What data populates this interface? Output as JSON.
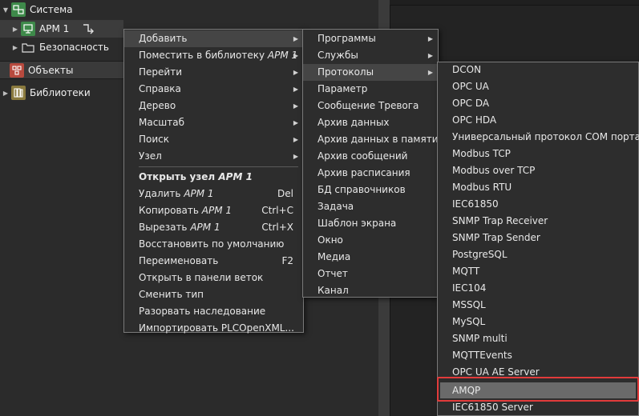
{
  "tree": {
    "sistema": "Система",
    "arm1": "АРМ 1",
    "bezopasnost": "Безопасность",
    "obekty": "Объекты",
    "biblioteki": "Библиотеки"
  },
  "menu_main": {
    "items": [
      {
        "label": "Добавить",
        "submenu": true
      },
      {
        "label": "Поместить в библиотеку ",
        "italic": "АРМ 1",
        "submenu": true
      },
      {
        "label": "Перейти",
        "submenu": true
      },
      {
        "label": "Справка",
        "submenu": true
      },
      {
        "label": "Дерево",
        "submenu": true
      },
      {
        "label": "Масштаб",
        "submenu": true
      },
      {
        "label": "Поиск",
        "submenu": true
      },
      {
        "label": "Узел",
        "submenu": true
      },
      {
        "label": "Открыть узел ",
        "italic": "АРМ 1",
        "bold": true
      },
      {
        "label": "Удалить ",
        "italic": "АРМ 1",
        "shortcut": "Del"
      },
      {
        "label": "Копировать ",
        "italic": "АРМ 1",
        "shortcut": "Ctrl+C"
      },
      {
        "label": "Вырезать ",
        "italic": "АРМ 1",
        "shortcut": "Ctrl+X"
      },
      {
        "label": "Восстановить по умолчанию"
      },
      {
        "label": "Переименовать",
        "shortcut": "F2"
      },
      {
        "label": "Открыть в панели веток"
      },
      {
        "label": "Сменить тип"
      },
      {
        "label": "Разорвать наследование"
      },
      {
        "label": "Импортировать PLCOpenXML..."
      }
    ]
  },
  "menu_add": {
    "items": [
      {
        "label": "Программы",
        "submenu": true
      },
      {
        "label": "Службы",
        "submenu": true
      },
      {
        "label": "Протоколы",
        "submenu": true
      },
      {
        "label": "Параметр"
      },
      {
        "label": "Сообщение Тревога"
      },
      {
        "label": "Архив данных"
      },
      {
        "label": "Архив данных в памяти"
      },
      {
        "label": "Архив сообщений"
      },
      {
        "label": "Архив расписания"
      },
      {
        "label": "БД справочников"
      },
      {
        "label": "Задача"
      },
      {
        "label": "Шаблон экрана"
      },
      {
        "label": "Окно"
      },
      {
        "label": "Медиа"
      },
      {
        "label": "Отчет"
      },
      {
        "label": "Канал"
      }
    ]
  },
  "menu_protocols": {
    "items": [
      "DCON",
      "OPC UA",
      "OPC DA",
      "OPC HDA",
      "Универсальный протокол COM порта",
      "Modbus TCP",
      "Modbus over TCP",
      "Modbus RTU",
      "IEC61850",
      "SNMP Trap Receiver",
      "SNMP Trap Sender",
      "PostgreSQL",
      "MQTT",
      "IEC104",
      "MSSQL",
      "MySQL",
      "SNMP multi",
      "MQTTEvents",
      "OPC UA AE Server",
      "AMQP",
      "IEC61850 Server"
    ]
  }
}
